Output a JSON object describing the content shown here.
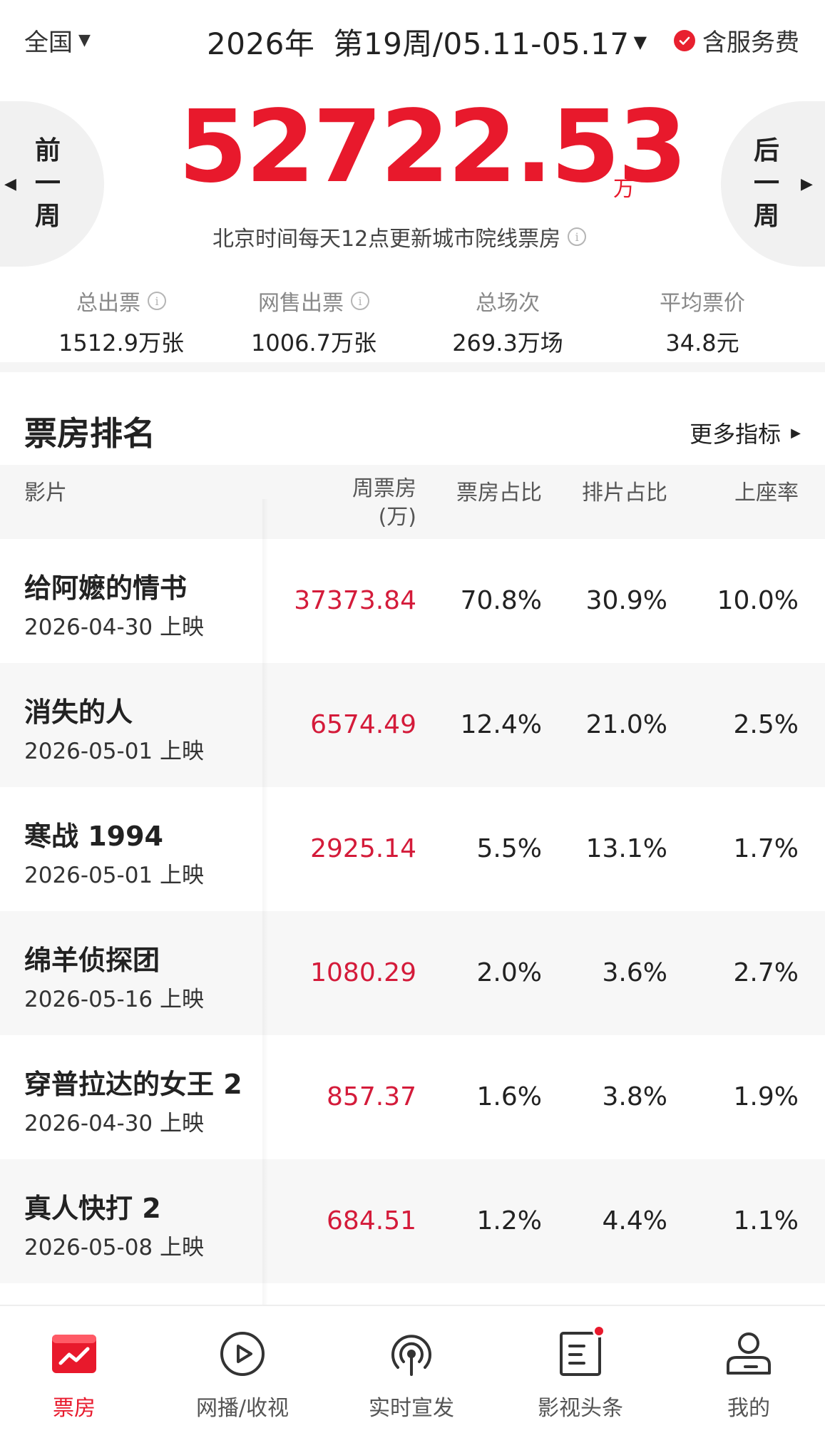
{
  "header": {
    "region": "全国",
    "year": "2026年",
    "week": "第19周/05.11-05.17",
    "service_fee": "含服务费"
  },
  "summary": {
    "prev_week": [
      "前",
      "一",
      "周"
    ],
    "next_week": [
      "后",
      "一",
      "周"
    ],
    "total_box_office": "52722.53",
    "unit": "万",
    "update_note": "北京时间每天12点更新城市院线票房"
  },
  "stats": [
    {
      "label": "总出票",
      "value": "1512.9万张",
      "info": true
    },
    {
      "label": "网售出票",
      "value": "1006.7万张",
      "info": true
    },
    {
      "label": "总场次",
      "value": "269.3万场",
      "info": false
    },
    {
      "label": "平均票价",
      "value": "34.8元",
      "info": false
    }
  ],
  "ranking": {
    "title": "票房排名",
    "more": "更多指标",
    "columns": {
      "film": "影片",
      "weekly_box": "周票房",
      "weekly_box_unit": "(万)",
      "box_share": "票房占比",
      "schedule_share": "排片占比",
      "occupancy": "上座率"
    },
    "rows": [
      {
        "name": "给阿嬷的情书",
        "date": "2026-04-30 上映",
        "box": "37373.84",
        "share": "70.8%",
        "schedule": "30.9%",
        "occupancy": "10.0%"
      },
      {
        "name": "消失的人",
        "date": "2026-05-01 上映",
        "box": "6574.49",
        "share": "12.4%",
        "schedule": "21.0%",
        "occupancy": "2.5%"
      },
      {
        "name": "寒战 1994",
        "date": "2026-05-01 上映",
        "box": "2925.14",
        "share": "5.5%",
        "schedule": "13.1%",
        "occupancy": "1.7%"
      },
      {
        "name": "绵羊侦探团",
        "date": "2026-05-16 上映",
        "box": "1080.29",
        "share": "2.0%",
        "schedule": "3.6%",
        "occupancy": "2.7%"
      },
      {
        "name": "穿普拉达的女王 2",
        "date": "2026-04-30 上映",
        "box": "857.37",
        "share": "1.6%",
        "schedule": "3.8%",
        "occupancy": "1.9%"
      },
      {
        "name": "真人快打 2",
        "date": "2026-05-08 上映",
        "box": "684.51",
        "share": "1.2%",
        "schedule": "4.4%",
        "occupancy": "1.1%"
      }
    ]
  },
  "bottom_nav": [
    {
      "label": "票房",
      "icon": "box-office-chart-icon",
      "active": true
    },
    {
      "label": "网播/收视",
      "icon": "play-circle-icon",
      "active": false
    },
    {
      "label": "实时宣发",
      "icon": "broadcast-icon",
      "active": false
    },
    {
      "label": "影视头条",
      "icon": "news-document-icon",
      "active": false,
      "badge": true
    },
    {
      "label": "我的",
      "icon": "user-profile-icon",
      "active": false
    }
  ],
  "colors": {
    "accent": "#e8192c",
    "box_value": "#d41b3a"
  }
}
